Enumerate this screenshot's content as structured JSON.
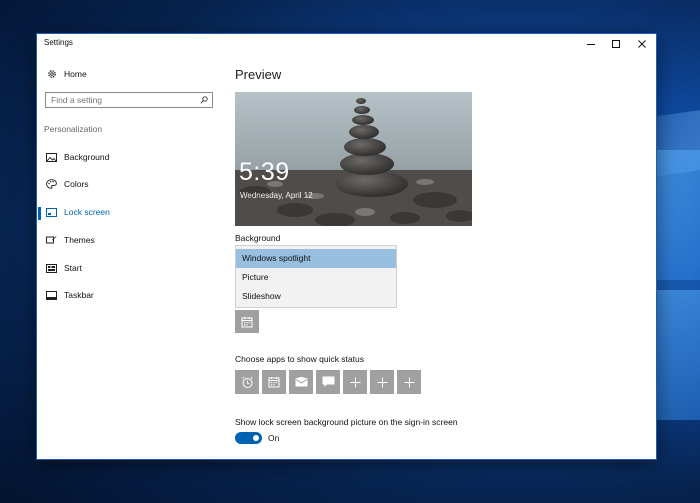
{
  "window": {
    "title": "Settings"
  },
  "sidebar": {
    "home_label": "Home",
    "search_placeholder": "Find a setting",
    "section_label": "Personalization",
    "items": [
      {
        "label": "Background",
        "icon": "picture-icon"
      },
      {
        "label": "Colors",
        "icon": "palette-icon"
      },
      {
        "label": "Lock screen",
        "icon": "lock-screen-icon",
        "active": true
      },
      {
        "label": "Themes",
        "icon": "themes-icon"
      },
      {
        "label": "Start",
        "icon": "start-icon"
      },
      {
        "label": "Taskbar",
        "icon": "taskbar-icon"
      }
    ]
  },
  "main": {
    "heading": "Preview",
    "preview": {
      "time": "5:39",
      "date": "Wednesday, April 12"
    },
    "background_label": "Background",
    "background_options": [
      "Windows spotlight",
      "Picture",
      "Slideshow"
    ],
    "background_selected": "Windows spotlight",
    "quick_status_label": "Choose apps to show quick status",
    "quick_status_icons": [
      "alarm-icon",
      "calendar-icon",
      "mail-icon",
      "message-icon",
      "plus-icon",
      "plus-icon",
      "plus-icon"
    ],
    "signin_label": "Show lock screen background picture on the sign-in screen",
    "signin_toggle_label": "On",
    "signin_toggle_on": true
  },
  "colors": {
    "accent": "#0063b1",
    "selected_option": "#98bfe0",
    "tile": "#a0a0a0"
  }
}
